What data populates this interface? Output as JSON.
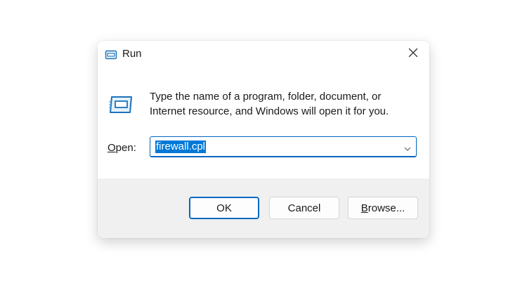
{
  "window": {
    "title": "Run",
    "title_icon": "run-icon",
    "close_icon": "close-icon"
  },
  "body": {
    "icon": "run-icon",
    "message_line1": "Type the name of a program, folder, document, or",
    "message_line2": "Internet resource, and Windows will open it for you.",
    "open_label_mnemonic": "O",
    "open_label_rest": "pen:",
    "open_input": {
      "value": "firewall.cpl",
      "selected": true,
      "dropdown_icon": "chevron-down-icon"
    }
  },
  "buttons": {
    "ok_label": "OK",
    "cancel_label": "Cancel",
    "browse_mnemonic": "B",
    "browse_rest": "rowse..."
  },
  "colors": {
    "accent": "#0067c0",
    "selection": "#0078d7",
    "footer_bg": "#f0f0f0"
  }
}
